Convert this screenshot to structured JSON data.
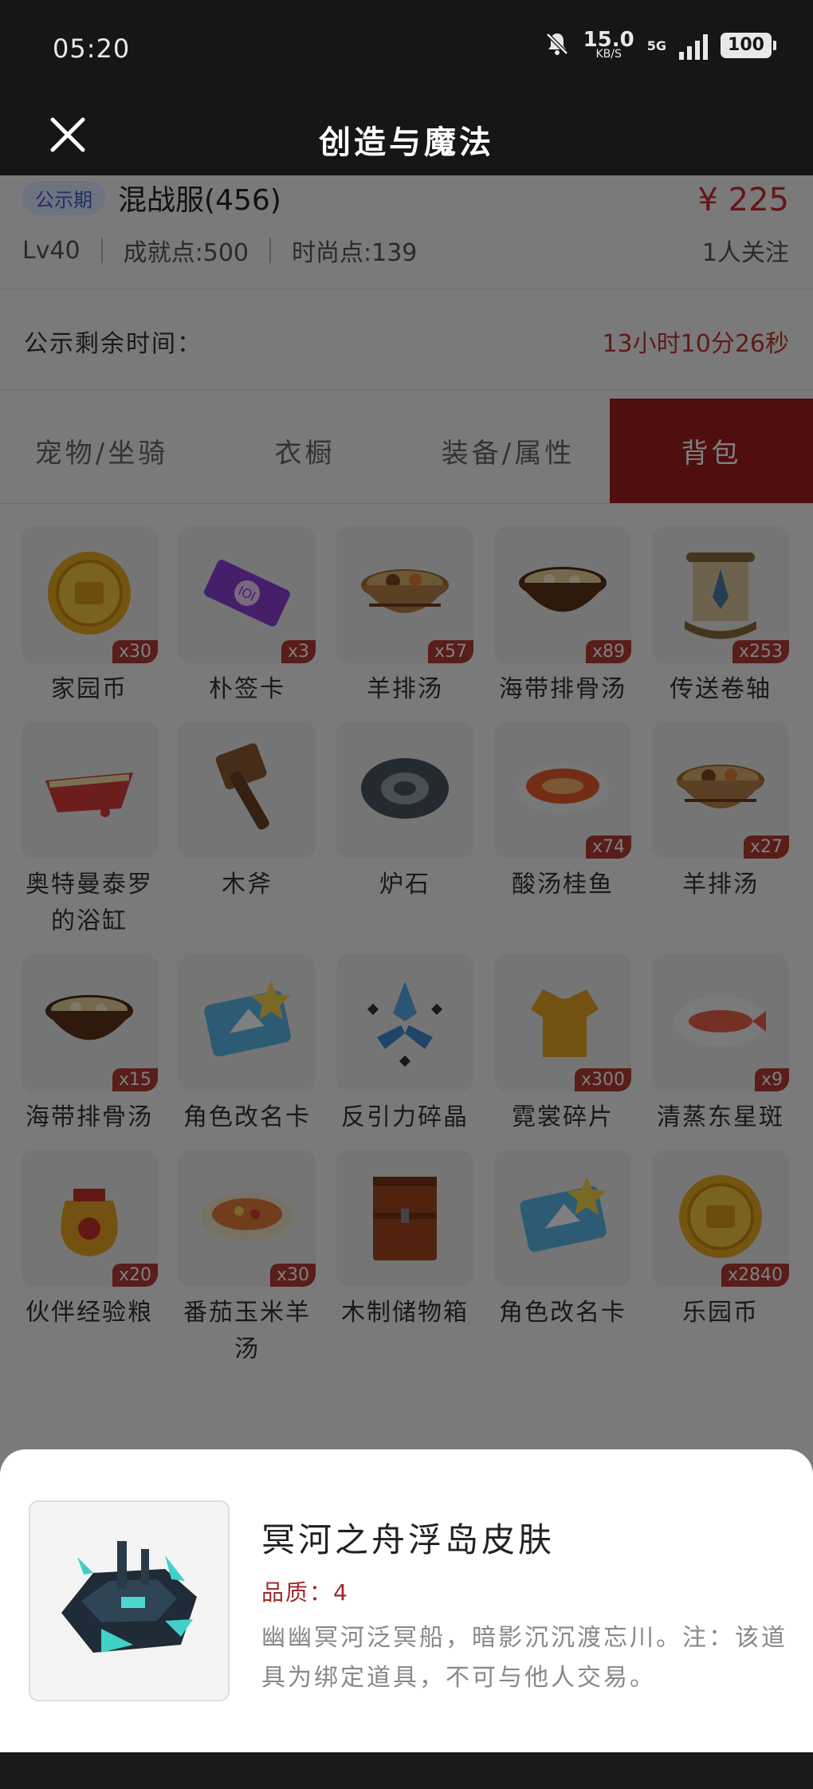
{
  "status_bar": {
    "time": "05:20",
    "speed_value": "15.0",
    "speed_unit": "KB/S",
    "network": "5G",
    "battery": "100"
  },
  "nav": {
    "title": "创造与魔法"
  },
  "account": {
    "tag": "公示期",
    "server": "混战服(456)",
    "price": "¥ 225",
    "level": "Lv40",
    "achievement": "成就点:500",
    "fashion": "时尚点:139",
    "followers": "1人关注"
  },
  "countdown": {
    "label": "公示剩余时间：",
    "value": "13小时10分26秒"
  },
  "tabs": [
    {
      "label": "宠物/坐骑"
    },
    {
      "label": "衣橱"
    },
    {
      "label": "装备/属性"
    },
    {
      "label": "背包"
    }
  ],
  "items": [
    {
      "name": "家园币",
      "qty": "x30",
      "icon": "gold-coin"
    },
    {
      "name": "朴签卡",
      "qty": "x3",
      "icon": "purple-ticket"
    },
    {
      "name": "羊排汤",
      "qty": "x57",
      "icon": "stew-bowl"
    },
    {
      "name": "海带排骨汤",
      "qty": "x89",
      "icon": "soup-bowl"
    },
    {
      "name": "传送卷轴",
      "qty": "x253",
      "icon": "scroll"
    },
    {
      "name": "奥特曼泰罗的浴缸",
      "qty": "",
      "icon": "bathtub"
    },
    {
      "name": "木斧",
      "qty": "",
      "icon": "wood-axe"
    },
    {
      "name": "炉石",
      "qty": "",
      "icon": "hearthstone"
    },
    {
      "name": "酸汤桂鱼",
      "qty": "x74",
      "icon": "fish-soup"
    },
    {
      "name": "羊排汤",
      "qty": "x27",
      "icon": "stew-bowl"
    },
    {
      "name": "海带排骨汤",
      "qty": "x15",
      "icon": "soup-bowl"
    },
    {
      "name": "角色改名卡",
      "qty": "",
      "icon": "rename-card"
    },
    {
      "name": "反引力碎晶",
      "qty": "",
      "icon": "crystal"
    },
    {
      "name": "霓裳碎片",
      "qty": "x300",
      "icon": "shirt"
    },
    {
      "name": "清蒸东星斑",
      "qty": "x9",
      "icon": "steamed-fish"
    },
    {
      "name": "伙伴经验粮",
      "qty": "x20",
      "icon": "food-sack"
    },
    {
      "name": "番茄玉米羊汤",
      "qty": "x30",
      "icon": "tomato-soup"
    },
    {
      "name": "木制储物箱",
      "qty": "",
      "icon": "wooden-chest"
    },
    {
      "name": "角色改名卡",
      "qty": "",
      "icon": "rename-card"
    },
    {
      "name": "乐园币",
      "qty": "x2840",
      "icon": "gold-coin"
    }
  ],
  "detail": {
    "title": "冥河之舟浮岛皮肤",
    "quality": "品质：4",
    "description": "幽幽冥河泛冥船，暗影沉沉渡忘川。注：该道具为绑定道具，不可与他人交易。"
  },
  "colors": {
    "accent_red": "#9f1f1f",
    "price_red": "#cf2a2a",
    "tag_blue": "#3d63c8"
  }
}
